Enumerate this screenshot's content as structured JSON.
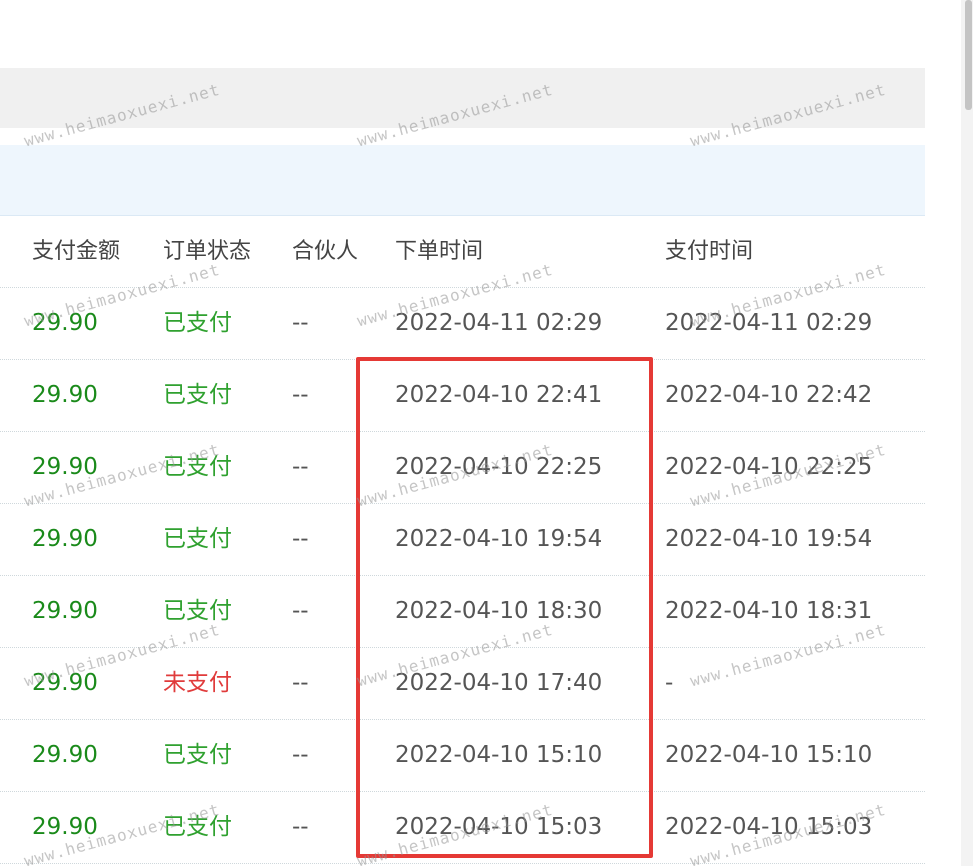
{
  "table": {
    "headers": {
      "amount": "支付金额",
      "status": "订单状态",
      "partner": "合伙人",
      "order_time": "下单时间",
      "pay_time": "支付时间"
    },
    "rows": [
      {
        "amount": "29.90",
        "status": "已支付",
        "status_type": "paid",
        "partner": "--",
        "order_time": "2022-04-11 02:29",
        "pay_time": "2022-04-11 02:29"
      },
      {
        "amount": "29.90",
        "status": "已支付",
        "status_type": "paid",
        "partner": "--",
        "order_time": "2022-04-10 22:41",
        "pay_time": "2022-04-10 22:42"
      },
      {
        "amount": "29.90",
        "status": "已支付",
        "status_type": "paid",
        "partner": "--",
        "order_time": "2022-04-10 22:25",
        "pay_time": "2022-04-10 22:25"
      },
      {
        "amount": "29.90",
        "status": "已支付",
        "status_type": "paid",
        "partner": "--",
        "order_time": "2022-04-10 19:54",
        "pay_time": "2022-04-10 19:54"
      },
      {
        "amount": "29.90",
        "status": "已支付",
        "status_type": "paid",
        "partner": "--",
        "order_time": "2022-04-10 18:30",
        "pay_time": "2022-04-10 18:31"
      },
      {
        "amount": "29.90",
        "status": "未支付",
        "status_type": "unpaid",
        "partner": "--",
        "order_time": "2022-04-10 17:40",
        "pay_time": "-"
      },
      {
        "amount": "29.90",
        "status": "已支付",
        "status_type": "paid",
        "partner": "--",
        "order_time": "2022-04-10 15:10",
        "pay_time": "2022-04-10 15:10"
      },
      {
        "amount": "29.90",
        "status": "已支付",
        "status_type": "paid",
        "partner": "--",
        "order_time": "2022-04-10 15:03",
        "pay_time": "2022-04-10 15:03"
      }
    ]
  },
  "watermark": {
    "text": "www.heimaoxuexi.net"
  },
  "colors": {
    "amount": "#1a8a1a",
    "paid": "#2fa12f",
    "unpaid": "#e03b3b",
    "highlight": "#e53935"
  }
}
